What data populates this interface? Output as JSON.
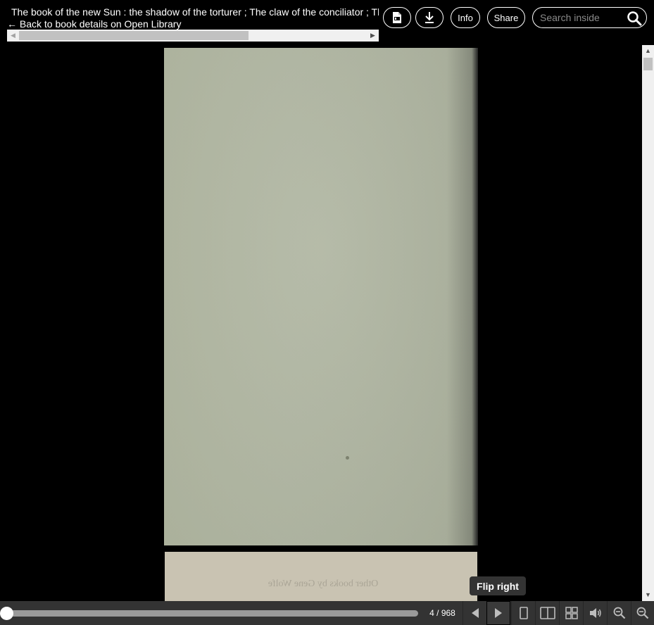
{
  "header": {
    "title": "The book of the new Sun : the shadow of the torturer ; The claw of the conciliator ; The sword of the lictor ; The citadel of the autarch",
    "back_link": "← Back to book details on Open Library",
    "info_label": "Info",
    "share_label": "Share",
    "search_placeholder": "Search inside",
    "icons": [
      "pdf-icon",
      "download-icon",
      "search-icon"
    ]
  },
  "viewer": {
    "next_page_text": "Other books by Gene Wolfe"
  },
  "tooltip": {
    "text": "Flip right"
  },
  "navbar": {
    "page_indicator": "4 / 968",
    "progress": 0.003,
    "icons": [
      "flip-left-icon",
      "flip-right-icon",
      "one-page-view-icon",
      "two-page-view-icon",
      "thumbnail-view-icon",
      "read-aloud-icon",
      "zoom-out-icon",
      "zoom-in-icon"
    ]
  }
}
